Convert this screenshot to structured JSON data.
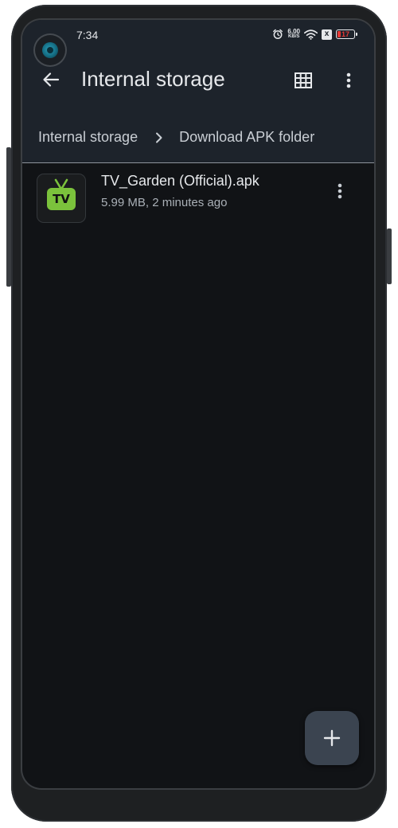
{
  "status_bar": {
    "time": "7:34",
    "net_speed_value": "6.00",
    "net_speed_unit": "KB/S",
    "sim_label": "x",
    "battery_level": "17",
    "battery_fraction": 0.17
  },
  "app_bar": {
    "title": "Internal storage",
    "icons": [
      "arrow-back-icon",
      "grid-view-icon",
      "more-vert-icon"
    ]
  },
  "breadcrumb": {
    "items": [
      "Internal storage",
      "Download APK folder"
    ]
  },
  "files": [
    {
      "name": "TV_Garden (Official).apk",
      "meta": "5.99 MB, 2 minutes ago",
      "thumb_text": "TV"
    }
  ],
  "fab": {
    "icon": "plus-icon"
  },
  "colors": {
    "app_bar_bg": "#1d232b",
    "screen_bg": "#111316",
    "fab_bg": "#3b4450",
    "tv_green": "#7bc23c",
    "battery_low": "#e53935"
  }
}
